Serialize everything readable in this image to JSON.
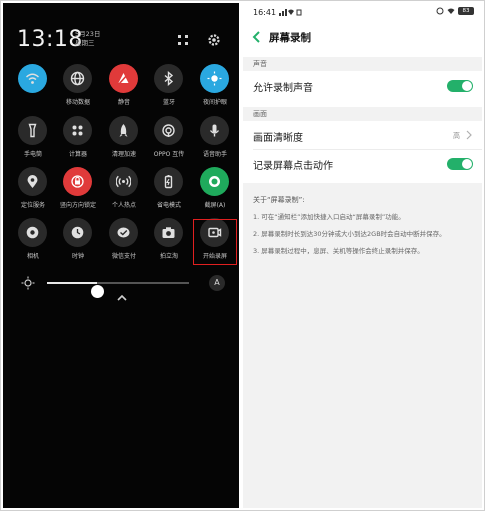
{
  "left": {
    "clock": "13:18",
    "date_line1": "5月23日",
    "date_line2": "星期三",
    "tiles": [
      {
        "label": "",
        "icon": "wifi-icon",
        "state": "on",
        "blur": true
      },
      {
        "label": "移动数据",
        "icon": "globe-icon",
        "state": "off"
      },
      {
        "label": "静音",
        "icon": "bell-off-icon",
        "state": "red"
      },
      {
        "label": "蓝牙",
        "icon": "bluetooth-icon",
        "state": "off"
      },
      {
        "label": "夜间护眼",
        "icon": "eye-care-icon",
        "state": "on"
      },
      {
        "label": "手电筒",
        "icon": "flashlight-icon",
        "state": "off"
      },
      {
        "label": "计算器",
        "icon": "calculator-icon",
        "state": "off"
      },
      {
        "label": "清理加速",
        "icon": "rocket-icon",
        "state": "off"
      },
      {
        "label": "OPPO 互传",
        "icon": "share-icon",
        "state": "off"
      },
      {
        "label": "语音助手",
        "icon": "microphone-icon",
        "state": "off"
      },
      {
        "label": "定位服务",
        "icon": "location-icon",
        "state": "off"
      },
      {
        "label": "竖向方向锁定",
        "icon": "rotation-lock-icon",
        "state": "red"
      },
      {
        "label": "个人热点",
        "icon": "hotspot-icon",
        "state": "off"
      },
      {
        "label": "省电模式",
        "icon": "battery-icon",
        "state": "off"
      },
      {
        "label": "截屏(A)",
        "icon": "screenshot-icon",
        "state": "green"
      },
      {
        "label": "相机",
        "icon": "camera-aperture-icon",
        "state": "off"
      },
      {
        "label": "时钟",
        "icon": "clock-icon",
        "state": "off"
      },
      {
        "label": "微信支付",
        "icon": "wechat-pay-icon",
        "state": "off"
      },
      {
        "label": "拍立淘",
        "icon": "camera-icon",
        "state": "off"
      },
      {
        "label": "开始录屏",
        "icon": "screen-record-icon",
        "state": "off"
      }
    ],
    "brightness_level": 0.35,
    "auto_brightness_label": "A"
  },
  "right": {
    "status_time": "16:41",
    "battery_level": "83",
    "page_title": "屏幕录制",
    "section_sound": "声音",
    "allow_sound_label": "允许录制声音",
    "section_picture": "画面",
    "clarity_label": "画面清晰度",
    "clarity_value": "高",
    "record_touch_label": "记录屏幕点击动作",
    "about_title": "关于“屏幕录制”:",
    "notes": [
      "1. 可在“通知栏”添加快捷入口启动“屏幕录制”功能。",
      "2. 屏幕录制时长到达30分钟或大小到达2GB时会自动中断并保存。",
      "3. 屏幕录制过程中，息屏、关机等操作会终止录制并保存。"
    ],
    "colors": {
      "toggle_on": "#23b06a",
      "accent": "#23b06a"
    }
  }
}
